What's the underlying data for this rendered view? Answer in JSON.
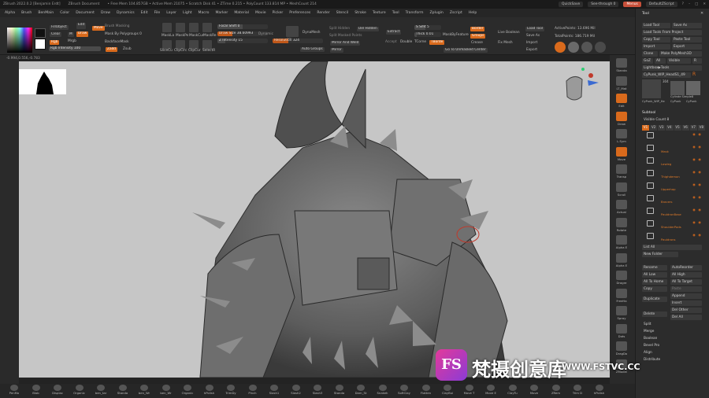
{
  "titlebar": {
    "app": "ZBrush 2022.0.2 [Benjamin Erdt]",
    "doc": "ZBrush Document",
    "mem": "• Free Mem 104.857GB • Active Mem 21075 • Scratch Disk 41 • ZTime 0.215 • PolyCount 133.814 MP • MeshCount 214",
    "quicksave": "QuickSave",
    "seethrough": "See-through 0",
    "menus": "Menus",
    "script": "DefaultZScript"
  },
  "menubar": [
    "Alpha",
    "Brush",
    "BenMain",
    "Color",
    "Document",
    "Draw",
    "Dynamics",
    "Edit",
    "File",
    "Layer",
    "Light",
    "Macro",
    "Marker",
    "Material",
    "Movie",
    "Picker",
    "Preferences",
    "Render",
    "Stencil",
    "Stroke",
    "Texture",
    "Tool",
    "Transform",
    "Zplugin",
    "Zscript",
    "Help"
  ],
  "toolbar": {
    "fillobject": "FillObject",
    "clear": "Clear",
    "m": "M",
    "rgb": "Rgb",
    "mrgb": "Mrgb",
    "rgbint": "Rgb Intensity 100",
    "rgbint_val": 1.0,
    "edit": "Edit",
    "draw": "Draw",
    "move": "Move",
    "scale": "Scale",
    "rotate": "Rotate",
    "brushmask": "Brush Masking",
    "maskpoly": "Mask By Polygroups 0",
    "backface": "BackfaceMask",
    "zadd": "Zadd",
    "zsub": "Zsub",
    "masklist": [
      "MaskLa",
      "MaskPe",
      "MaskCur",
      "MaskRe"
    ],
    "focal": "Focal Shift 0",
    "drawsize": "Draw Size 38.60993",
    "dynamic": "Dynamic",
    "zint": "Z Intensity 15",
    "slicecu": "SliceCu",
    "clipcirc": "ClipCirc",
    "clipcur": "ClipCur",
    "selectr": "SelectR",
    "sdiv": "SDiv",
    "dynamesh": "DynaMesh",
    "resolution": "Resolution 324",
    "autogroups": "Auto Groups",
    "splithidden": "Split Hidden",
    "delhidden": "Del Hidden",
    "splitmasked": "Split Masked Points",
    "mirrorweld": "Mirror And Weld",
    "mirror": "Mirror",
    "extract": "Extract",
    "thick": "Thick 0.01",
    "accept": "Accept",
    "double": "Double",
    "tcorne": "TCorne",
    "tborder": "TBorde",
    "smt": "S Smt 5",
    "maskbyfeature": "MaskByFeature",
    "border": "Border",
    "groups": "Groups",
    "crease": "Crease",
    "gotounmasked": "Go To Unmasked Center",
    "livebool": "Live Boolean",
    "fixmesh": "Fix Mesh",
    "loadtool": "Load Tool",
    "saveas": "Save As",
    "import": "Import",
    "export": "Export",
    "activepoints": "ActivePoints: 13.696 Mil",
    "totalpoints": "TotalPoints: 186.719 Mil"
  },
  "coords": "-0.994,0.556,-0.783",
  "leftshelf": [],
  "rightshelf": [
    "Standa",
    "LT_Mat",
    "Edit",
    "Draw",
    "L.Sym",
    "Move",
    "Transp",
    "Scroll",
    "Actual",
    "Rotate",
    "Alpha E",
    "Alpha E",
    "Dragre",
    "FreeHa",
    "Spray",
    "Dots",
    "DragDo",
    "ZModel"
  ],
  "bottombar": [
    "PenMo",
    "Blob",
    "Displac",
    "Organic",
    "ben_tar",
    "Standa",
    "ben_Wr",
    "ben_Wr",
    "Organic",
    "hPolish",
    "TrimDy",
    "Pinch",
    "Slash1",
    "Slash2",
    "Slash3",
    "Standa",
    "Dam_St",
    "Snakeh",
    "SoftClay",
    "Flatten",
    "ClayBui",
    "Move T",
    "Move E",
    "ClayTu",
    "Move",
    "ZRem",
    "Trim D",
    "hPolish"
  ],
  "tool": {
    "title": "Tool",
    "loadtool": "Load Tool",
    "saveas": "Save As",
    "copytool": "Copy Tool",
    "pastetool": "Paste Tool",
    "loadfromproject": "Load Tools From Project",
    "import": "Import",
    "export": "Export",
    "clone": "Clone",
    "makepolymesh": "Make PolyMesh3D",
    "goz": "GoZ",
    "all": "All",
    "visible": "Visible",
    "r": "R",
    "lightbox": "Lightbox▶Tools",
    "current": "CyPunk_WIP_HeadS1_49",
    "count": "304",
    "cyl": "Cylinde Simple8",
    "polymesh": "PolyMes",
    "cypunk": "CyPunk_WIP_He",
    "cyp2": "CyPunk",
    "cyp3": "CyPunk"
  },
  "subtool": {
    "title": "Subtool",
    "visiblecount": "Visible Count 8",
    "vtabs": [
      "V1",
      "V2",
      "V3",
      "V4",
      "V5",
      "V6",
      "V7",
      "V8"
    ],
    "items": [
      {
        "name": ""
      },
      {
        "name": "Mask"
      },
      {
        "name": "Lowleg"
      },
      {
        "name": "Thighdemon"
      },
      {
        "name": "Upperhop"
      },
      {
        "name": "Bracers"
      },
      {
        "name": "PauldronBase"
      },
      {
        "name": "ShoulderPads"
      },
      {
        "name": "Pauldrons"
      }
    ],
    "listall": "List All",
    "newfolder": "New Folder",
    "rename": "Rename",
    "autoreorder": "AutoReorder",
    "alllow": "All Low",
    "allhigh": "All High",
    "alltohome": "All To Home",
    "alltotarget": "All To Target",
    "copy": "Copy",
    "paste": "Paste",
    "duplicate": "Duplicate",
    "append": "Append",
    "insert": "Insert",
    "delete": "Delete",
    "delother": "Del Other",
    "delall": "Del All",
    "split": "Split",
    "merge": "Merge",
    "boolean": "Boolean",
    "bevelpro": "Bevel Pro",
    "align": "Align",
    "distribute": "Distribute"
  },
  "watermark": {
    "logo": "FS",
    "cn": "梵摄创意库",
    "url": "WWW.FSTVC.CC"
  },
  "colors": {
    "accent": "#d96a1c",
    "canvas": "#c6c6c6",
    "panel": "#2c2c2c"
  }
}
